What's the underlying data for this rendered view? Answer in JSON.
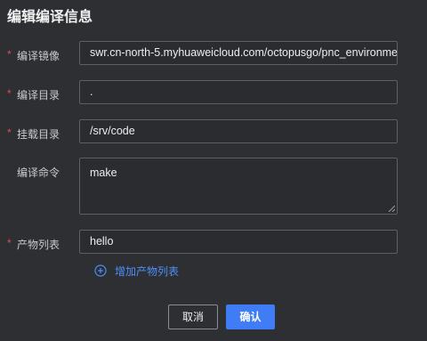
{
  "dialog": {
    "title": "编辑编译信息"
  },
  "form": {
    "required_mark": "*",
    "image": {
      "label": "编译镜像",
      "value": "swr.cn-north-5.myhuaweicloud.com/octopusgo/pnc_environme"
    },
    "build_dir": {
      "label": "编译目录",
      "value": "."
    },
    "mount_dir": {
      "label": "挂载目录",
      "value": "/srv/code"
    },
    "command": {
      "label": "编译命令",
      "value": "make"
    },
    "artifacts": {
      "label": "产物列表",
      "value": "hello"
    },
    "add_artifact": {
      "label": "增加产物列表",
      "icon": "plus-circle-icon"
    }
  },
  "footer": {
    "cancel_label": "取消",
    "confirm_label": "确认"
  },
  "colors": {
    "background": "#2d2f32",
    "input_border": "#5b5e63",
    "required": "#e04e4e",
    "accent": "#3f7cf5",
    "link": "#4d8ff8"
  }
}
